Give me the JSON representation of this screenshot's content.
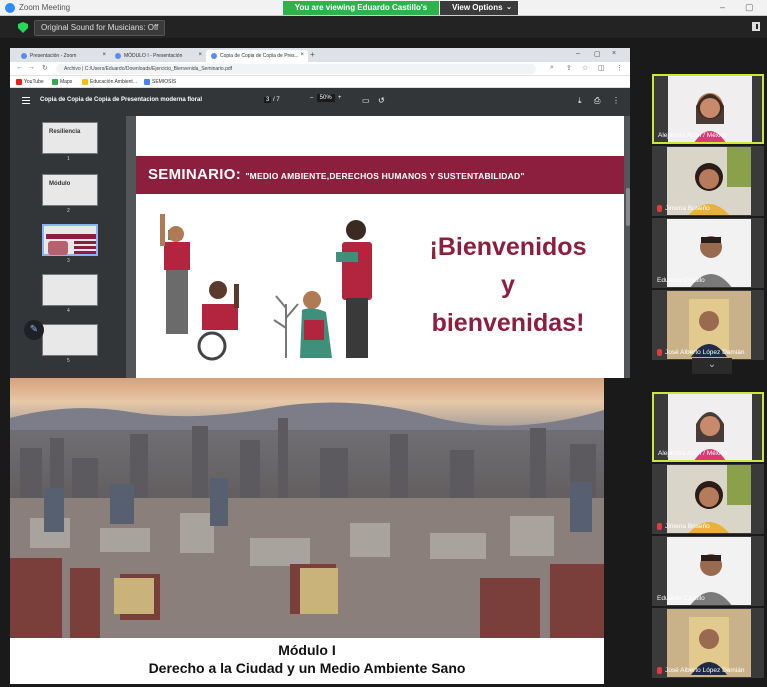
{
  "titlebar": {
    "app_title": "Zoom Meeting",
    "share_banner": "You are viewing Eduardo Castillo's screen",
    "view_options": "View Options",
    "minimize": "–",
    "maximize": "▢"
  },
  "toolbar": {
    "sound_button": "Original Sound for Musicians: Off"
  },
  "browser": {
    "tabs": [
      {
        "label": "Presentación - Zoom"
      },
      {
        "label": "MÓDULO I - Presentación"
      },
      {
        "label": "Copia de Copia de Copia de Pres..."
      }
    ],
    "address": "Archivo  |  C:/Users/Eduardo/Downloads/Ejercicio_Bienvenida_Seminario.pdf",
    "bookmarks": [
      {
        "label": "YouTube",
        "color": "#e62117"
      },
      {
        "label": "Maps",
        "color": "#34a853"
      },
      {
        "label": "Educación Ambient...",
        "color": "#fbbc05"
      },
      {
        "label": "SEMIOSIS",
        "color": "#4285f4"
      }
    ]
  },
  "pdf": {
    "title": "Copia de Copia de Copia de Presentacion moderna floral",
    "page_current": "3",
    "page_total": "/ 7",
    "zoom": "50%",
    "thumbnails": [
      {
        "num": "1",
        "title": "Resiliencia"
      },
      {
        "num": "2",
        "title": "Módulo"
      },
      {
        "num": "3",
        "title": ""
      },
      {
        "num": "4",
        "title": ""
      },
      {
        "num": "5",
        "title": ""
      }
    ]
  },
  "slide": {
    "seminar_label": "SEMINARIO:",
    "seminar_topic": "\"MEDIO AMBIENTE,DERECHOS HUMANOS Y SUSTENTABILIDAD\"",
    "welcome_line1": "¡Bienvenidos",
    "welcome_line2": "y",
    "welcome_line3": "bienvenidas!"
  },
  "feed": {
    "caption_line1": "Módulo I",
    "caption_line2": "Derecho a la Ciudad y un Medio Ambiente Sano"
  },
  "participants_top": [
    {
      "name": "Alejandra Atzin / México",
      "muted": false,
      "active": true
    },
    {
      "name": "Jimena Briseño",
      "muted": true,
      "active": false
    },
    {
      "name": "Eduardo Castillo",
      "muted": false,
      "active": false
    },
    {
      "name": "José Alberto López Damián",
      "muted": true,
      "active": false
    }
  ],
  "participants_bottom": [
    {
      "name": "Alejandra Atzin / México",
      "muted": false,
      "active": true
    },
    {
      "name": "Jimena Briseño",
      "muted": true,
      "active": false
    },
    {
      "name": "Eduardo Castillo",
      "muted": false,
      "active": false
    },
    {
      "name": "José Alberto López Damián",
      "muted": true,
      "active": false
    }
  ],
  "colors": {
    "brand_wine": "#8c1f3d",
    "share_green": "#2fb24c",
    "active_speaker": "#c9e83a",
    "zoom_blue": "#2d8cff"
  }
}
